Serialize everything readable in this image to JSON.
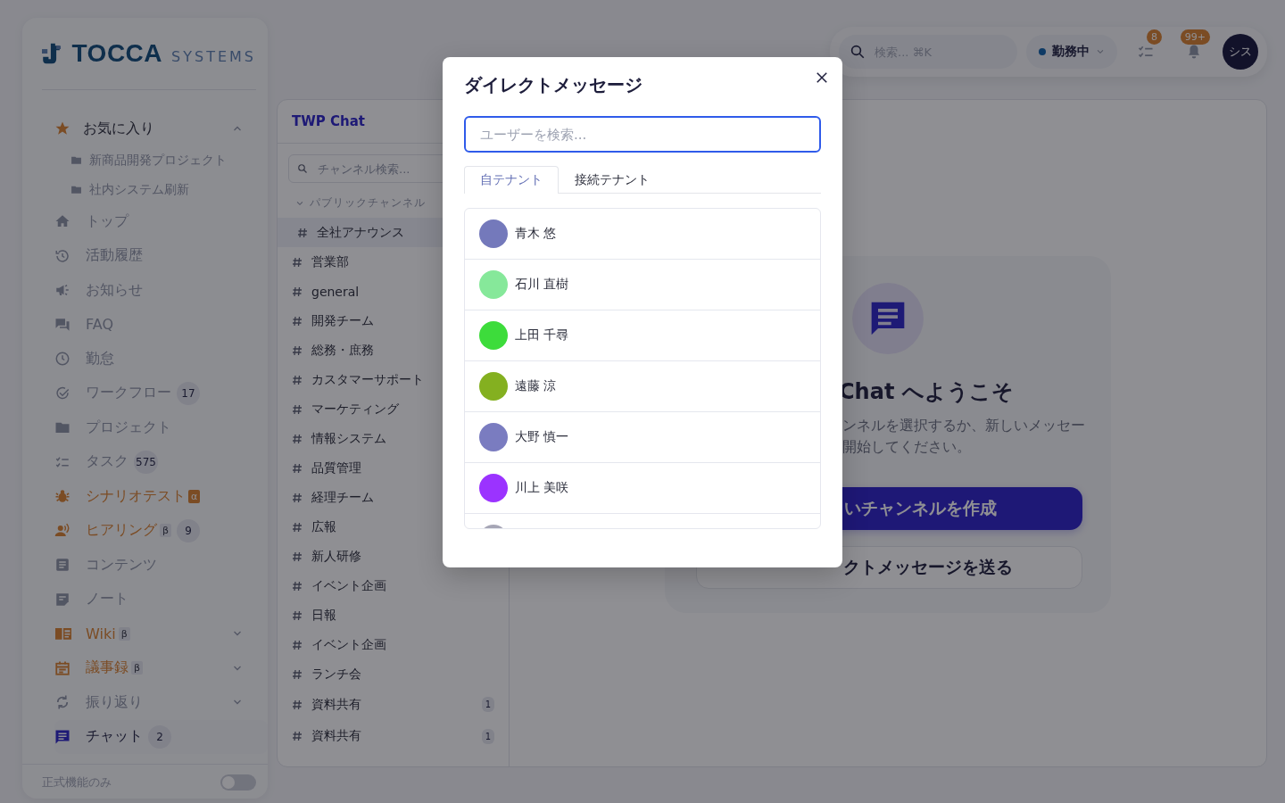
{
  "sidebar": {
    "logo": {
      "wordmark": "TOCCA",
      "suffix": "SYSTEMS"
    },
    "favorites": {
      "label": "お気に入り",
      "expanded": true,
      "children": [
        {
          "label": "新商品開発プロジェクト"
        },
        {
          "label": "社内システム刷新"
        }
      ]
    },
    "items": [
      {
        "label": "トップ",
        "accent": false,
        "selected": false
      },
      {
        "label": "活動履歴",
        "accent": false,
        "selected": false
      },
      {
        "label": "お知らせ",
        "accent": false,
        "selected": false
      },
      {
        "label": "FAQ",
        "accent": false,
        "selected": false
      },
      {
        "label": "勤怠",
        "accent": false,
        "selected": false
      },
      {
        "label": "ワークフロー",
        "accent": false,
        "selected": false,
        "badge": "17"
      },
      {
        "label": "プロジェクト",
        "accent": false,
        "selected": false
      },
      {
        "label": "タスク",
        "accent": false,
        "selected": false,
        "badge": "575"
      },
      {
        "label": "シナリオテスト",
        "accent": true,
        "selected": false,
        "tag": "α",
        "tag_filled": true
      },
      {
        "label": "ヒアリング",
        "accent": true,
        "selected": false,
        "tag": "β",
        "tag_filled": false,
        "badge": "9"
      },
      {
        "label": "コンテンツ",
        "accent": false,
        "selected": false
      },
      {
        "label": "ノート",
        "accent": false,
        "selected": false
      },
      {
        "label": "Wiki",
        "accent": true,
        "selected": false,
        "tag": "β",
        "tag_filled": false,
        "expanded": false
      },
      {
        "label": "議事録",
        "accent": true,
        "selected": false,
        "tag": "β",
        "tag_filled": false,
        "expanded": false
      },
      {
        "label": "振り返り",
        "accent": false,
        "selected": false,
        "expanded": false
      },
      {
        "label": "チャット",
        "accent": false,
        "selected": true,
        "badge": "2"
      }
    ],
    "footer": {
      "label": "正式機能のみ",
      "on": false
    }
  },
  "topbar": {
    "search": {
      "placeholder": "検索... ⌘K"
    },
    "status": {
      "label": "勤務中"
    },
    "task_badge": "8",
    "notification_badge": "99+",
    "avatar": "シス"
  },
  "channel_panel": {
    "title": "TWP Chat",
    "search": {
      "placeholder": "チャンネル検索..."
    },
    "section": {
      "label": "パブリックチャンネル",
      "expanded": true
    },
    "channels": [
      {
        "name": "全社アナウンス",
        "selected": true
      },
      {
        "name": "営業部",
        "selected": false
      },
      {
        "name": "general",
        "selected": false
      },
      {
        "name": "開発チーム",
        "selected": false
      },
      {
        "name": "総務・庶務",
        "selected": false
      },
      {
        "name": "カスタマーサポート",
        "selected": false
      },
      {
        "name": "マーケティング",
        "selected": false
      },
      {
        "name": "情報システム",
        "selected": false
      },
      {
        "name": "品質管理",
        "selected": false
      },
      {
        "name": "経理チーム",
        "selected": false
      },
      {
        "name": "広報",
        "selected": false
      },
      {
        "name": "新人研修",
        "selected": false
      },
      {
        "name": "イベント企画",
        "selected": false
      },
      {
        "name": "日報",
        "selected": false
      },
      {
        "name": "イベント企画",
        "selected": false
      },
      {
        "name": "ランチ会",
        "selected": false
      },
      {
        "name": "資料共有",
        "selected": false,
        "unread": "1"
      },
      {
        "name": "資料共有",
        "selected": false,
        "unread": "1"
      }
    ]
  },
  "welcome": {
    "heading": "Chat へようこそ",
    "description_lines": [
      "ンネルを選択するか、新しいメッセー",
      "開始してください。"
    ],
    "buttons": [
      {
        "label": "いチャンネルを作成",
        "kind": "primary"
      },
      {
        "label": "クトメッセージを送る",
        "kind": "secondary"
      }
    ]
  },
  "dialog": {
    "title": "ダイレクトメッセージ",
    "search": {
      "placeholder": "ユーザーを検索..."
    },
    "tabs": [
      {
        "label": "自テナント",
        "selected": true
      },
      {
        "label": "接続テナント",
        "selected": false
      }
    ],
    "users": [
      {
        "name": "青木 悠",
        "color": "#7479bb"
      },
      {
        "name": "石川 直樹",
        "color": "#86e89a"
      },
      {
        "name": "上田 千尋",
        "color": "#3ddc3b"
      },
      {
        "name": "遠藤 涼",
        "color": "#84b020"
      },
      {
        "name": "大野 慎一",
        "color": "#7a7cc0"
      },
      {
        "name": "川上 美咲",
        "color": "#9b33ff"
      },
      {
        "color": "#a6a6b6"
      }
    ]
  }
}
